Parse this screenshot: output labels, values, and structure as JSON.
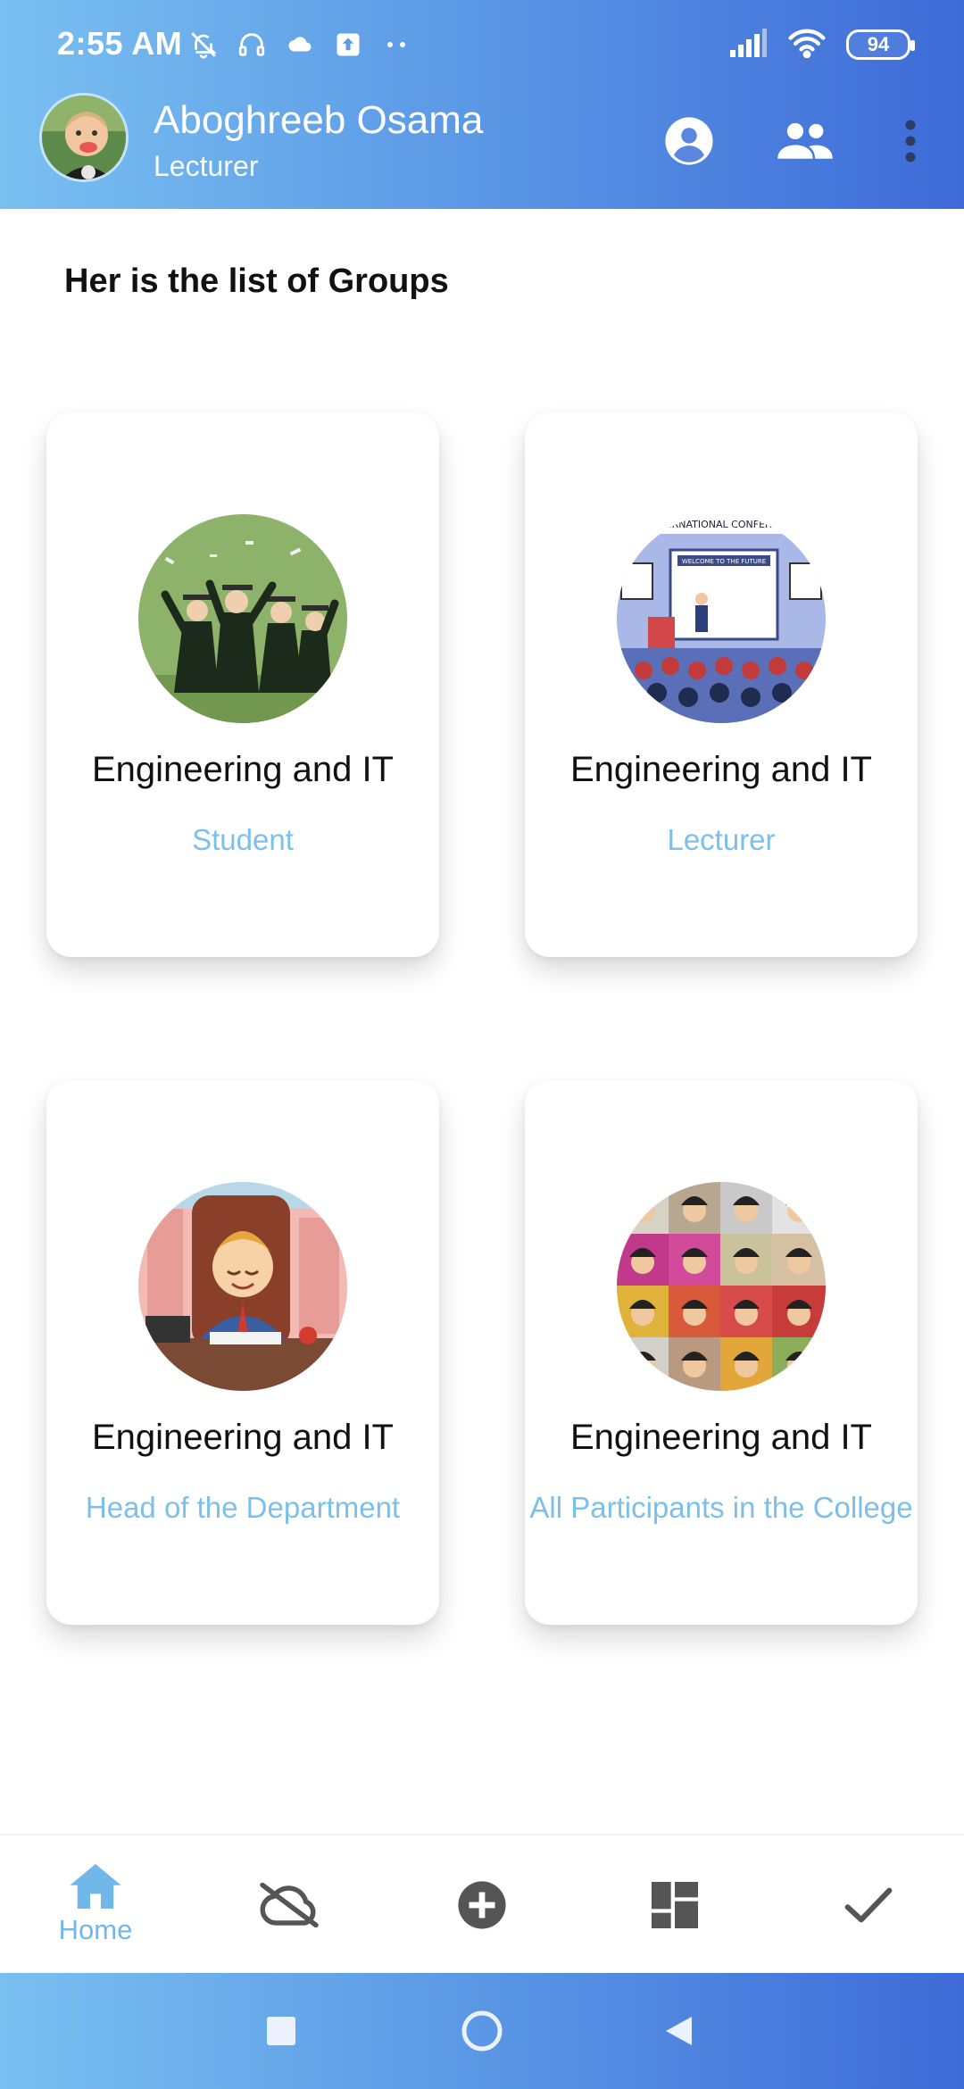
{
  "status_bar": {
    "time": "2:55 AM",
    "battery": "94",
    "icons": [
      "bell-off-icon",
      "headset-icon",
      "cloud-icon",
      "upload-icon",
      "more-dots-icon",
      "signal-icon",
      "wifi-icon",
      "battery-icon"
    ]
  },
  "header": {
    "user_name": "Aboghreeb Osama",
    "user_role": "Lecturer",
    "actions": [
      "account-icon",
      "group-icon",
      "more-vert-icon"
    ]
  },
  "main": {
    "heading": "Her is the list of Groups",
    "groups": [
      {
        "title": "Engineering and IT",
        "subtitle": "Student",
        "image": "graduates-illustration"
      },
      {
        "title": "Engineering and IT",
        "subtitle": "Lecturer",
        "image": "conference-illustration"
      },
      {
        "title": "Engineering and IT",
        "subtitle": "Head of the Department",
        "image": "office-head-illustration"
      },
      {
        "title": "Engineering and IT",
        "subtitle": "All Participants in the College",
        "image": "participants-grid-illustration"
      }
    ]
  },
  "bottom_nav": {
    "items": [
      {
        "label": "Home",
        "icon": "home-icon",
        "active": true
      },
      {
        "label": "",
        "icon": "cloud-off-icon"
      },
      {
        "label": "",
        "icon": "add-circle-icon"
      },
      {
        "label": "",
        "icon": "dashboard-icon"
      },
      {
        "label": "",
        "icon": "check-icon"
      }
    ]
  },
  "colors": {
    "header_gradient_start": "#79c0f1",
    "header_gradient_end": "#3e6bd8",
    "accent": "#7cc0ea",
    "nav_icon": "#555555"
  }
}
